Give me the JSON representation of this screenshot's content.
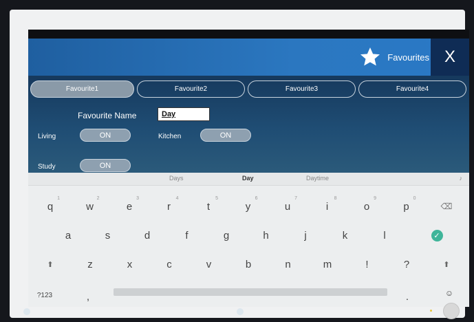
{
  "header": {
    "title": "Favourites",
    "close_label": "X"
  },
  "tabs": [
    "Favourite1",
    "Favourite2",
    "Favourite3",
    "Favourite4"
  ],
  "active_tab": "Favourite1",
  "form": {
    "name_label": "Favourite Name",
    "name_value": "Day",
    "rooms": [
      {
        "label": "Living",
        "state": "ON"
      },
      {
        "label": "Kitchen",
        "state": "ON"
      },
      {
        "label": "Study",
        "state": "ON"
      }
    ]
  },
  "keyboard": {
    "suggestions": [
      "Days",
      "Day",
      "Daytime"
    ],
    "row1": [
      "q",
      "w",
      "e",
      "r",
      "t",
      "y",
      "u",
      "i",
      "o",
      "p"
    ],
    "row1_hints": [
      "1",
      "2",
      "3",
      "4",
      "5",
      "6",
      "7",
      "8",
      "9",
      "0"
    ],
    "row2": [
      "a",
      "s",
      "d",
      "f",
      "g",
      "h",
      "j",
      "k",
      "l"
    ],
    "row3": [
      "z",
      "x",
      "c",
      "v",
      "b",
      "n",
      "m",
      "!",
      "?"
    ],
    "symbols_key": "?123",
    "comma_key": ",",
    "period_key": "."
  },
  "colors": {
    "header_blue": "#2b77c0",
    "close_bg": "#0f2c55",
    "accent_green": "#3fb59a"
  }
}
